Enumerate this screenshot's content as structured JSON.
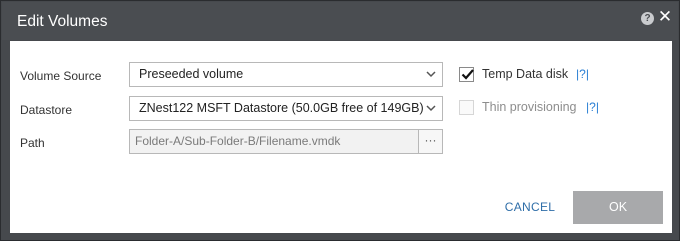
{
  "dialog": {
    "title": "Edit Volumes",
    "help_icon": "question-circle-icon",
    "close_icon": "close-icon",
    "close_glyph": "✕",
    "help_glyph": "?"
  },
  "form": {
    "volume_source": {
      "label": "Volume Source",
      "value": "Preseeded volume"
    },
    "datastore": {
      "label": "Datastore",
      "value": "ZNest122 MSFT Datastore (50.0GB free of 149GB)"
    },
    "path": {
      "label": "Path",
      "value": "Folder-A/Sub-Folder-B/Filename.vmdk",
      "browse_label": "···"
    }
  },
  "options": {
    "temp_data_disk": {
      "label": "Temp Data disk",
      "checked": true,
      "help": "?"
    },
    "thin_provisioning": {
      "label": "Thin provisioning",
      "checked": false,
      "disabled": true,
      "help": "?"
    }
  },
  "footer": {
    "cancel_label": "CANCEL",
    "ok_label": "OK"
  },
  "colors": {
    "frame": "#46494d",
    "link": "#2a7fd4",
    "ok_button": "#a8a9ab"
  }
}
